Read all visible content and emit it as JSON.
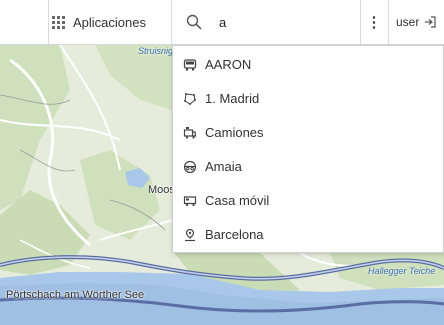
{
  "header": {
    "apps_label": "Aplicaciones",
    "search_value": "a",
    "user_label": "user"
  },
  "search_results": [
    {
      "label": "AARON",
      "icon": "bus-icon"
    },
    {
      "label": "1. Madrid",
      "icon": "polygon-area-icon"
    },
    {
      "label": "Camiones",
      "icon": "vehicle-group-icon"
    },
    {
      "label": "Amaia",
      "icon": "person-icon"
    },
    {
      "label": "Casa móvil",
      "icon": "motorhome-icon"
    },
    {
      "label": "Barcelona",
      "icon": "place-marker-icon"
    }
  ],
  "map": {
    "labels": {
      "top_place": "Struisnig",
      "moos": "Moos",
      "portschach": "Pörtschach am Wörther See",
      "hallegger": "Hallegger Teiche"
    }
  }
}
